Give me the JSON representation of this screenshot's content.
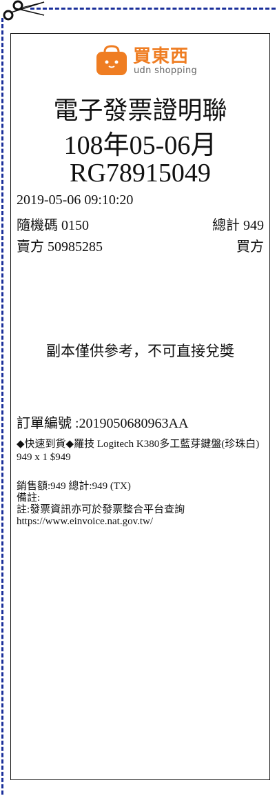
{
  "logo": {
    "brand_cn": "買東西",
    "brand_en": "udn shopping",
    "icon": "shopping-bag-icon",
    "color": "#ef7d22"
  },
  "invoice": {
    "title": "電子發票證明聯",
    "period": "108年05-06月",
    "number": "RG78915049",
    "datetime": "2019-05-06 09:10:20",
    "random_code": "隨機碼 0150",
    "total": "總計 949",
    "seller": "賣方 50985285",
    "buyer": "買方"
  },
  "notice": "副本僅供參考，不可直接兌獎",
  "order": {
    "number_label": "訂單編號 :2019050680963AA",
    "item": "◆快速到貨◆羅技 Logitech K380多工藍芽鍵盤(珍珠白) 949 x 1 $949"
  },
  "details": {
    "sales": "銷售額:949 總計:949 (TX)",
    "remark": "備註:",
    "note": "註:發票資訊亦可於發票整合平台查詢",
    "url": "https://www.einvoice.nat.gov.tw/"
  },
  "colors": {
    "dashed_border": "#1a2f9a"
  }
}
